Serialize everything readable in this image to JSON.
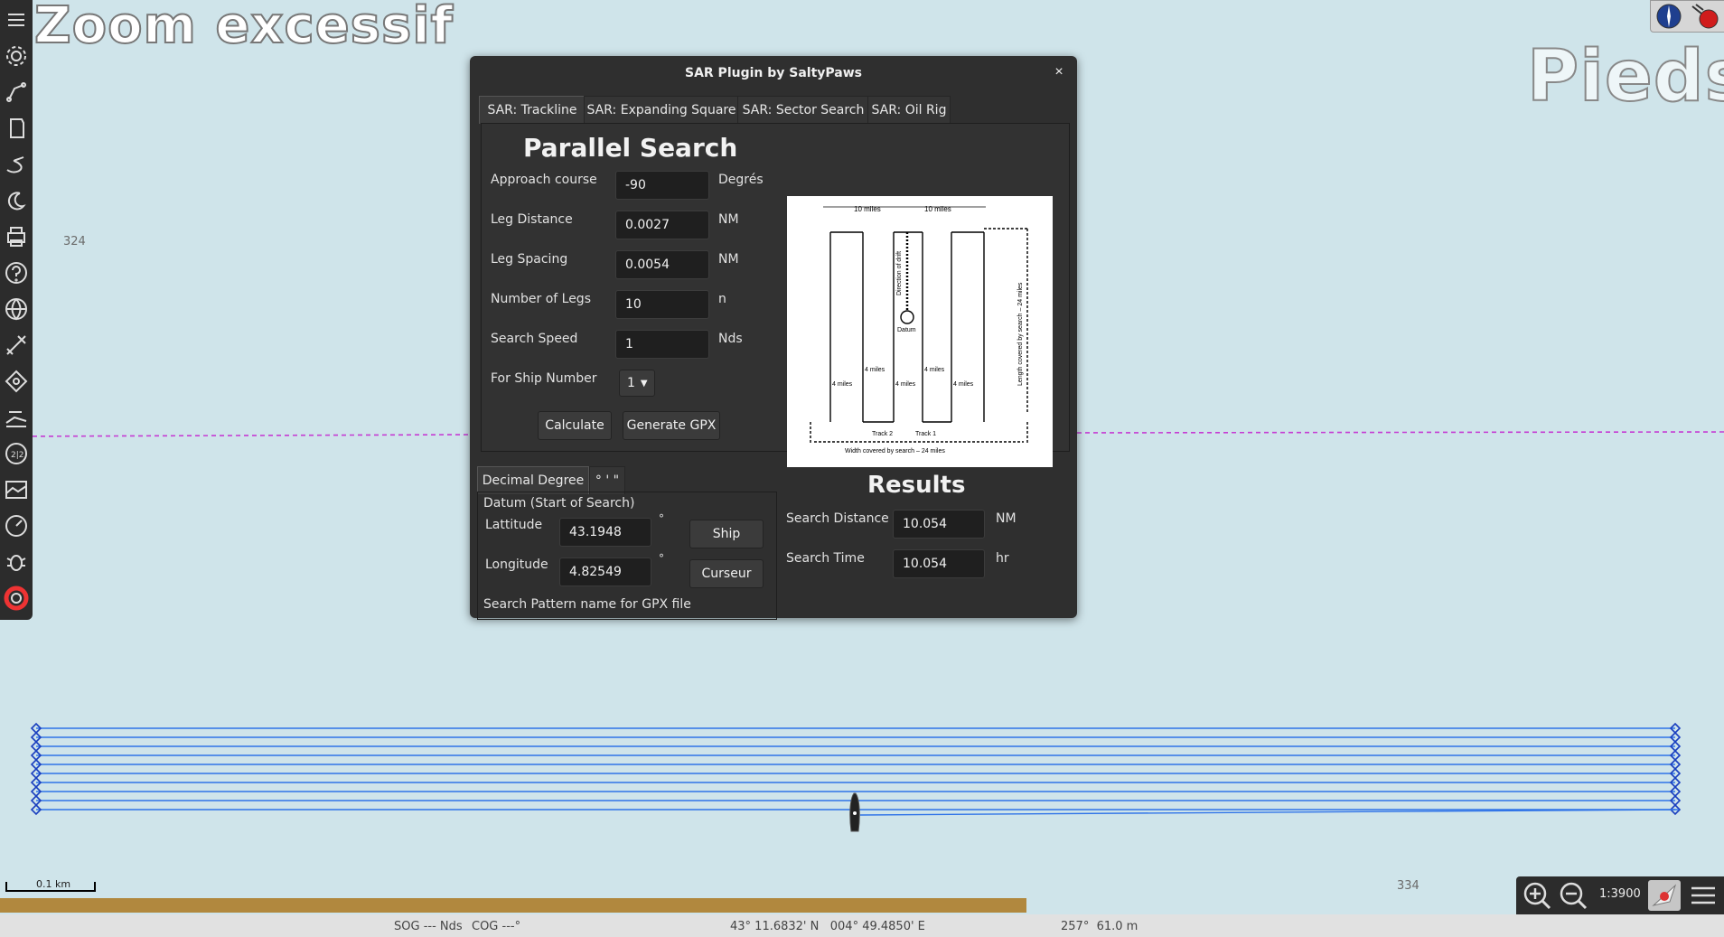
{
  "chart_overlay": {
    "zoom_warning": "Zoom excessif",
    "units": "Pieds",
    "depth_labels": [
      "324",
      "334"
    ],
    "scale_label": "0.1 km",
    "colors": {
      "sea": "#cfe4ea",
      "route": "#2f73e8",
      "boundary": "#c53bd3",
      "land_strip": "#b1883e"
    }
  },
  "toolbar": {
    "icons": [
      "menu-icon",
      "settings-icon",
      "route-icon",
      "layers-icon",
      "track-icon",
      "night-mode-icon",
      "print-icon",
      "help-icon",
      "globe-icon",
      "measure-icon",
      "waypoint-icon",
      "chart-icon",
      "dashboard-icon",
      "photo-icon",
      "gauge-icon",
      "bug-icon",
      "lifebuoy-icon"
    ]
  },
  "dialog": {
    "title": "SAR Plugin by SaltyPaws",
    "close_symbol": "×",
    "tabs": [
      "SAR: Trackline",
      "SAR: Expanding Square",
      "SAR: Sector Search",
      "SAR: Oil Rig"
    ],
    "active_tab": 0,
    "parallel": {
      "heading": "Parallel Search",
      "fields": [
        {
          "label": "Approach course",
          "value": "-90",
          "unit": "Degrés"
        },
        {
          "label": "Leg Distance",
          "value": "0.0027",
          "unit": "NM"
        },
        {
          "label": "Leg Spacing",
          "value": "0.0054",
          "unit": "NM"
        },
        {
          "label": "Number of Legs",
          "value": "10",
          "unit": "n"
        },
        {
          "label": "Search Speed",
          "value": "1",
          "unit": "Nds"
        }
      ],
      "ship_label": "For Ship Number",
      "ship_value": "1",
      "calculate": "Calculate",
      "generate_gpx": "Generate GPX"
    },
    "diagram_text": {
      "miles_top": "10 miles",
      "drift": "Direction of drift",
      "datum": "Datum",
      "length": "Length covered by search – 24 miles",
      "four_miles": "4 miles",
      "track2": "Track 2",
      "track1": "Track 1",
      "width": "Width covered by search – 24 miles"
    },
    "coord_tabs": [
      "Decimal Degree",
      "° ' \""
    ],
    "datum": {
      "group_label": "Datum (Start of Search)",
      "lat_label": "Lattitude",
      "lat_value": "43.1948",
      "lon_label": "Longitude",
      "lon_value": "4.82549",
      "deg": "°",
      "ship_btn": "Ship",
      "cursor_btn": "Curseur",
      "pattern_label": "Search Pattern name for GPX file"
    },
    "results": {
      "heading": "Results",
      "distance_label": "Search Distance",
      "distance_value": "10.054",
      "distance_unit": "NM",
      "time_label": "Search Time",
      "time_value": "10.054",
      "time_unit": "hr"
    }
  },
  "status_bar": {
    "sog": "SOG --- Nds",
    "cog": "COG ---°",
    "position": "43° 11.6832' N   004° 49.4850' E",
    "bearing": "257°  61.0 m"
  },
  "zoom": {
    "scale": "1:3900"
  }
}
